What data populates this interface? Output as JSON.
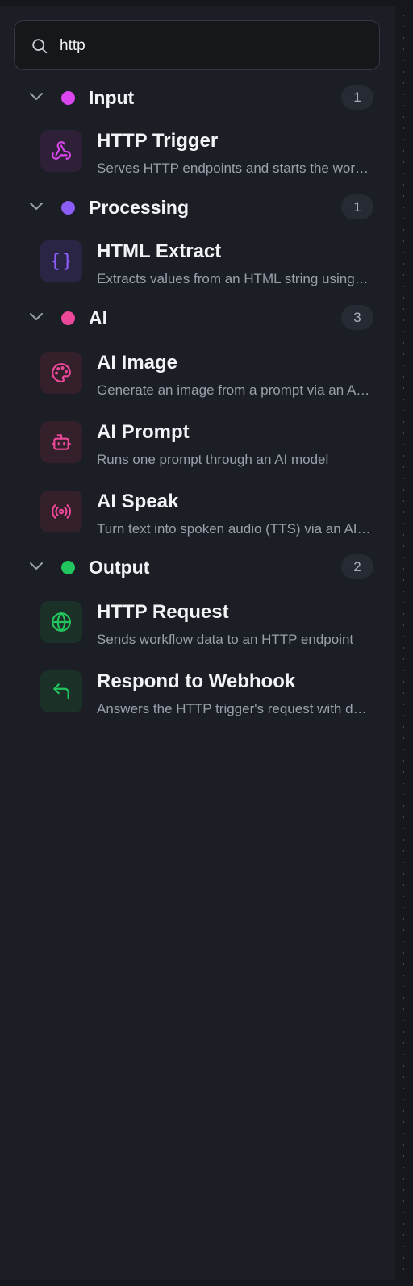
{
  "search": {
    "value": "http",
    "placeholder": ""
  },
  "colors": {
    "input": "#d946ef",
    "processing": "#8b5cf6",
    "ai": "#ec4899",
    "output": "#22c55e"
  },
  "groups": [
    {
      "title": "Input",
      "count": "1",
      "items": [
        {
          "name": "HTTP Trigger",
          "desc": "Serves HTTP endpoints and starts the workflow",
          "icon": "webhook-icon"
        }
      ]
    },
    {
      "title": "Processing",
      "count": "1",
      "items": [
        {
          "name": "HTML Extract",
          "desc": "Extracts values from an HTML string using selectors",
          "icon": "braces-icon"
        }
      ]
    },
    {
      "title": "AI",
      "count": "3",
      "items": [
        {
          "name": "AI Image",
          "desc": "Generate an image from a prompt via an AI model",
          "icon": "palette-icon"
        },
        {
          "name": "AI Prompt",
          "desc": "Runs one prompt through an AI model",
          "icon": "bot-icon"
        },
        {
          "name": "AI Speak",
          "desc": "Turn text into spoken audio (TTS) via an AI model",
          "icon": "broadcast-icon"
        }
      ]
    },
    {
      "title": "Output",
      "count": "2",
      "items": [
        {
          "name": "HTTP Request",
          "desc": "Sends workflow data to an HTTP endpoint",
          "icon": "globe-icon"
        },
        {
          "name": "Respond to Webhook",
          "desc": "Answers the HTTP trigger's request with data",
          "icon": "reply-icon"
        }
      ]
    }
  ]
}
